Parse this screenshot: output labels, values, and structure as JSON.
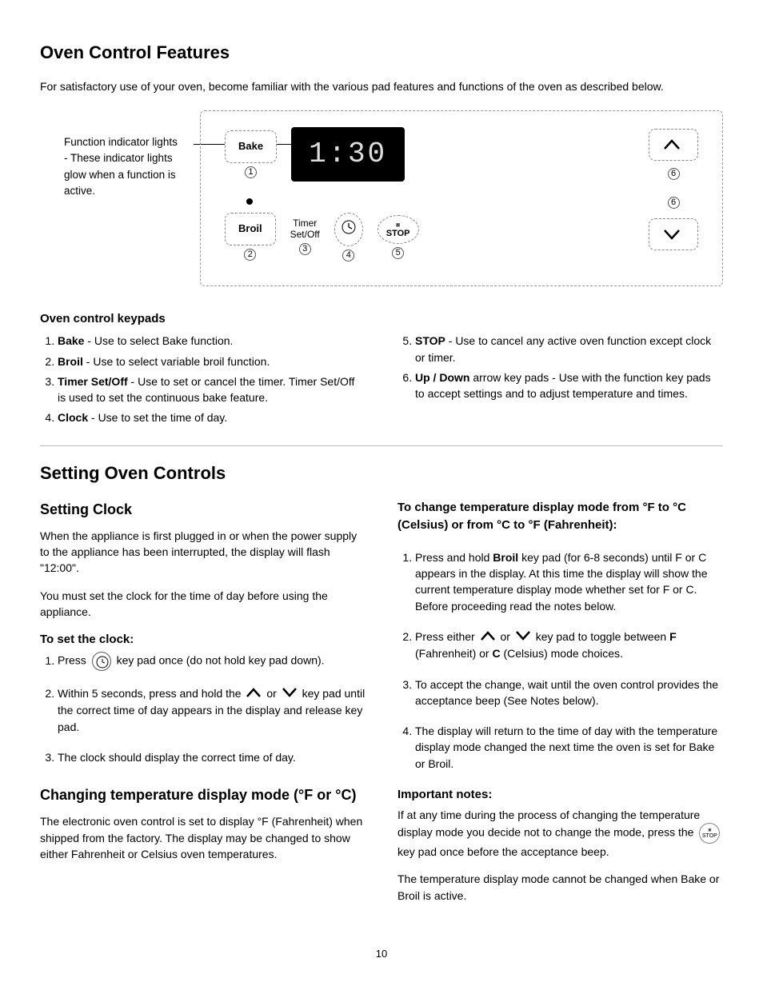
{
  "title1": "Oven Control Features",
  "intro": "For satisfactory use of your oven, become familiar with the various pad features and functions of the oven as described below.",
  "callout": "Function indicator lights - These indicator lights glow when a function is active.",
  "diagram": {
    "bake": "Bake",
    "broil": "Broil",
    "timer": "Timer\nSet/Off",
    "stop": "STOP",
    "display": "  1:30",
    "num_bake": "1",
    "num_broil": "2",
    "num_timer": "3",
    "num_clock": "4",
    "num_stop": "5",
    "num_up": "6",
    "num_down": "6"
  },
  "keypads_heading": "Oven control keypads",
  "keypads_left": [
    {
      "term": "Bake",
      "desc": " - Use to select Bake function."
    },
    {
      "term": "Broil",
      "desc": " - Use to select variable broil function."
    },
    {
      "term": "Timer Set/Off",
      "desc": " - Use to set or cancel the timer. Timer Set/Off is used to set the continuous bake feature."
    },
    {
      "term": "Clock",
      "desc": " - Use to set the time of day."
    }
  ],
  "keypads_right": [
    {
      "term": "STOP",
      "desc": " - Use to cancel any active oven function except clock or timer."
    },
    {
      "term": "Up / Down",
      "desc": " arrow key pads - Use with the function key pads to accept settings and to adjust temperature and times."
    }
  ],
  "title2": "Setting Oven Controls",
  "setting_clock_h": "Setting Clock",
  "setting_clock_p1": "When the appliance is first plugged in or when the power supply to the appliance has been interrupted, the display will flash \"12:00\".",
  "setting_clock_p2": "You must set the clock for the time of day before using the appliance.",
  "to_set_clock": "To set the clock:",
  "clock_step1_a": "Press ",
  "clock_step1_b": " key pad once (do not hold key pad down).",
  "clock_step2_a": "Within 5 seconds, press and hold the ",
  "clock_step2_b": " or ",
  "clock_step2_c": " key pad until the correct time of day appears in the display and release key pad.",
  "clock_step3": "The clock should display the correct time of day.",
  "temp_mode_h": "Changing temperature display mode (°F or °C)",
  "temp_mode_p": "The electronic oven control is set to display °F (Fahrenheit) when shipped from the factory. The display may be changed to show either Fahrenheit or Celsius oven temperatures.",
  "temp_change_h": "To change temperature display mode from °F  to °C (Celsius) or from °C to °F (Fahrenheit):",
  "temp_steps": [
    "Press and hold <strong>Broil</strong> key pad (for 6-8 seconds) until F or C appears in the display. At this time the display will show the current temperature display mode whether set for F or C. Before proceeding read the notes below.",
    "Press either [UP] or [DOWN] key pad to toggle between <strong>F</strong> (Fahrenheit) or <strong>C</strong> (Celsius) mode choices.",
    "To accept the change, wait until the oven control provides the acceptance beep (See Notes below).",
    "The display will return to the time of day with the temperature display mode changed the next time the oven is set for Bake or Broil."
  ],
  "notes_h": "Important notes:",
  "notes_p1a": "If at any time during the process of changing the temperature display mode you decide not to change the mode, press the ",
  "notes_p1b": " key pad once before the acceptance beep.",
  "notes_p2": "The temperature display mode cannot be changed when Bake or Broil is active.",
  "page": "10"
}
